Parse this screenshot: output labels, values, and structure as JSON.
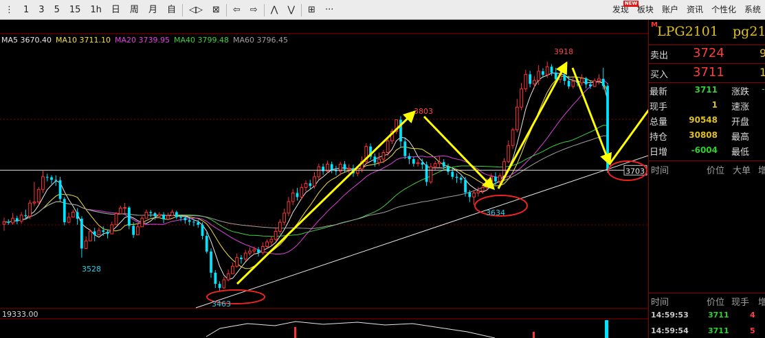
{
  "toolbar": {
    "items": [
      "⋮",
      "1",
      "3",
      "5",
      "15",
      "1h",
      "日",
      "周",
      "月",
      "自",
      "◁▷",
      "⊠",
      "⇦",
      "⇨",
      "⋀",
      "⋁",
      "⊞",
      "···"
    ],
    "right": [
      "发现",
      "板块",
      "账户",
      "资讯",
      "个性化",
      "系统"
    ],
    "new_badge": "NEW"
  },
  "ma_legend": [
    {
      "label": "MA5 3670.40",
      "color": "#e8e8e8"
    },
    {
      "label": "MA10 3711.10",
      "color": "#f0e040"
    },
    {
      "label": "MA20 3739.95",
      "color": "#e040e0"
    },
    {
      "label": "MA40 3799.48",
      "color": "#40d040"
    },
    {
      "label": "MA60 3796.45",
      "color": "#a0a0a0"
    }
  ],
  "volume_panel": {
    "label": "19333.00"
  },
  "chart_data": {
    "type": "candlestick",
    "y_range": [
      3440,
      3960
    ],
    "price_line": 3703,
    "price_line_label": "3703",
    "labels": [
      {
        "text": "3918",
        "price": 3918,
        "color": "#ff4444"
      },
      {
        "text": "3803",
        "price": 3803,
        "color": "#ff4444"
      },
      {
        "text": "3528",
        "price": 3528,
        "color": "#22d0e8"
      },
      {
        "text": "3463",
        "price": 3463,
        "color": "#22d0e8"
      },
      {
        "text": "3634",
        "price": 3634,
        "color": "#22d0e8"
      }
    ],
    "candles": [
      [
        3596,
        3601,
        3583,
        3609
      ],
      [
        3601,
        3599,
        3595,
        3606
      ],
      [
        3599,
        3608,
        3595,
        3618
      ],
      [
        3608,
        3602,
        3596,
        3613
      ],
      [
        3602,
        3614,
        3597,
        3620
      ],
      [
        3614,
        3612,
        3606,
        3625
      ],
      [
        3612,
        3638,
        3606,
        3644
      ],
      [
        3638,
        3640,
        3632,
        3680
      ],
      [
        3640,
        3665,
        3634,
        3670
      ],
      [
        3665,
        3690,
        3658,
        3702
      ],
      [
        3690,
        3689,
        3681,
        3696
      ],
      [
        3689,
        3684,
        3676,
        3693
      ],
      [
        3684,
        3683,
        3672,
        3693
      ],
      [
        3683,
        3646,
        3641,
        3690
      ],
      [
        3646,
        3600,
        3594,
        3650
      ],
      [
        3600,
        3610,
        3598,
        3619
      ],
      [
        3610,
        3620,
        3613,
        3625
      ],
      [
        3620,
        3607,
        3595,
        3628
      ],
      [
        3607,
        3548,
        3530,
        3612
      ],
      [
        3548,
        3563,
        3551,
        3572
      ],
      [
        3563,
        3582,
        3574,
        3586
      ],
      [
        3582,
        3575,
        3562,
        3589
      ],
      [
        3575,
        3584,
        3577,
        3590
      ],
      [
        3584,
        3581,
        3573,
        3592
      ],
      [
        3581,
        3577,
        3568,
        3586
      ],
      [
        3577,
        3595,
        3586,
        3601
      ],
      [
        3595,
        3617,
        3610,
        3620
      ],
      [
        3617,
        3628,
        3621,
        3633
      ],
      [
        3628,
        3629,
        3617,
        3638
      ],
      [
        3629,
        3593,
        3586,
        3632
      ],
      [
        3593,
        3575,
        3569,
        3600
      ],
      [
        3575,
        3591,
        3585,
        3597
      ],
      [
        3591,
        3608,
        3600,
        3612
      ],
      [
        3608,
        3620,
        3615,
        3625
      ],
      [
        3620,
        3618,
        3610,
        3624
      ],
      [
        3618,
        3612,
        3605,
        3620
      ],
      [
        3612,
        3615,
        3608,
        3620
      ],
      [
        3615,
        3606,
        3598,
        3620
      ],
      [
        3606,
        3613,
        3605,
        3619
      ],
      [
        3613,
        3620,
        3614,
        3625
      ],
      [
        3620,
        3610,
        3606,
        3623
      ],
      [
        3610,
        3609,
        3602,
        3615
      ],
      [
        3609,
        3604,
        3597,
        3612
      ],
      [
        3604,
        3601,
        3594,
        3610
      ],
      [
        3601,
        3600,
        3592,
        3606
      ],
      [
        3600,
        3595,
        3589,
        3605
      ],
      [
        3595,
        3573,
        3566,
        3600
      ],
      [
        3573,
        3542,
        3538,
        3580
      ],
      [
        3542,
        3500,
        3490,
        3548
      ],
      [
        3500,
        3478,
        3470,
        3505
      ],
      [
        3478,
        3470,
        3463,
        3483
      ],
      [
        3470,
        3486,
        3468,
        3492
      ],
      [
        3486,
        3498,
        3483,
        3506
      ],
      [
        3498,
        3513,
        3498,
        3520
      ],
      [
        3513,
        3530,
        3510,
        3538
      ],
      [
        3530,
        3527,
        3518,
        3535
      ],
      [
        3527,
        3539,
        3523,
        3545
      ],
      [
        3539,
        3543,
        3534,
        3550
      ],
      [
        3543,
        3546,
        3536,
        3552
      ],
      [
        3546,
        3540,
        3532,
        3551
      ],
      [
        3540,
        3552,
        3536,
        3560
      ],
      [
        3552,
        3561,
        3548,
        3566
      ],
      [
        3561,
        3566,
        3554,
        3572
      ],
      [
        3566,
        3582,
        3562,
        3590
      ],
      [
        3582,
        3600,
        3576,
        3606
      ],
      [
        3600,
        3618,
        3594,
        3627
      ],
      [
        3618,
        3641,
        3612,
        3650
      ],
      [
        3641,
        3658,
        3634,
        3666
      ],
      [
        3658,
        3650,
        3643,
        3668
      ],
      [
        3650,
        3669,
        3645,
        3676
      ],
      [
        3669,
        3677,
        3661,
        3683
      ],
      [
        3677,
        3672,
        3664,
        3684
      ],
      [
        3672,
        3690,
        3667,
        3699
      ],
      [
        3690,
        3710,
        3684,
        3716
      ],
      [
        3710,
        3701,
        3694,
        3716
      ],
      [
        3701,
        3715,
        3697,
        3722
      ],
      [
        3715,
        3703,
        3697,
        3720
      ],
      [
        3703,
        3701,
        3693,
        3712
      ],
      [
        3701,
        3715,
        3693,
        3720
      ],
      [
        3715,
        3705,
        3698,
        3721
      ],
      [
        3705,
        3707,
        3697,
        3715
      ],
      [
        3707,
        3697,
        3690,
        3714
      ],
      [
        3697,
        3706,
        3691,
        3711
      ],
      [
        3706,
        3720,
        3699,
        3730
      ],
      [
        3720,
        3750,
        3714,
        3756
      ],
      [
        3750,
        3730,
        3724,
        3756
      ],
      [
        3730,
        3718,
        3710,
        3736
      ],
      [
        3718,
        3725,
        3712,
        3738
      ],
      [
        3725,
        3738,
        3717,
        3743
      ],
      [
        3738,
        3761,
        3731,
        3768
      ],
      [
        3761,
        3780,
        3755,
        3785
      ],
      [
        3780,
        3803,
        3775,
        3803
      ],
      [
        3803,
        3760,
        3747,
        3810
      ],
      [
        3760,
        3731,
        3725,
        3766
      ],
      [
        3731,
        3725,
        3715,
        3737
      ],
      [
        3725,
        3716,
        3710,
        3730
      ],
      [
        3716,
        3718,
        3710,
        3725
      ],
      [
        3718,
        3714,
        3705,
        3726
      ],
      [
        3714,
        3680,
        3672,
        3720
      ],
      [
        3680,
        3710,
        3676,
        3717
      ],
      [
        3710,
        3716,
        3703,
        3721
      ],
      [
        3716,
        3719,
        3708,
        3730
      ],
      [
        3719,
        3710,
        3705,
        3725
      ],
      [
        3710,
        3700,
        3694,
        3716
      ],
      [
        3700,
        3690,
        3685,
        3710
      ],
      [
        3690,
        3688,
        3678,
        3697
      ],
      [
        3688,
        3684,
        3677,
        3692
      ],
      [
        3684,
        3659,
        3651,
        3690
      ],
      [
        3659,
        3650,
        3640,
        3664
      ],
      [
        3650,
        3658,
        3634,
        3664
      ],
      [
        3658,
        3662,
        3651,
        3670
      ],
      [
        3662,
        3669,
        3656,
        3677
      ],
      [
        3669,
        3681,
        3662,
        3687
      ],
      [
        3681,
        3690,
        3674,
        3697
      ],
      [
        3690,
        3681,
        3674,
        3699
      ],
      [
        3681,
        3692,
        3675,
        3697
      ],
      [
        3692,
        3720,
        3687,
        3727
      ],
      [
        3720,
        3752,
        3717,
        3762
      ],
      [
        3752,
        3783,
        3745,
        3787
      ],
      [
        3783,
        3828,
        3778,
        3844
      ],
      [
        3828,
        3864,
        3822,
        3876
      ],
      [
        3864,
        3893,
        3858,
        3902
      ],
      [
        3893,
        3874,
        3867,
        3900
      ],
      [
        3874,
        3881,
        3865,
        3889
      ],
      [
        3881,
        3899,
        3872,
        3911
      ],
      [
        3899,
        3892,
        3886,
        3905
      ],
      [
        3892,
        3908,
        3886,
        3918
      ],
      [
        3908,
        3896,
        3890,
        3913
      ],
      [
        3896,
        3883,
        3877,
        3906
      ],
      [
        3883,
        3892,
        3876,
        3900
      ],
      [
        3892,
        3880,
        3872,
        3898
      ],
      [
        3880,
        3869,
        3864,
        3890
      ],
      [
        3869,
        3879,
        3865,
        3887
      ],
      [
        3879,
        3876,
        3869,
        3888
      ],
      [
        3876,
        3885,
        3870,
        3893
      ],
      [
        3885,
        3873,
        3865,
        3888
      ],
      [
        3873,
        3869,
        3864,
        3880
      ],
      [
        3869,
        3880,
        3868,
        3885
      ],
      [
        3880,
        3884,
        3873,
        3893
      ],
      [
        3884,
        3870,
        3863,
        3906
      ],
      [
        3870,
        3705,
        3698,
        3876
      ]
    ],
    "volume_bars": [
      0,
      0,
      0,
      0,
      0,
      0,
      0,
      0,
      0,
      0,
      0,
      0,
      0,
      0,
      0,
      0,
      0,
      0,
      0,
      0,
      0,
      0,
      0,
      0,
      0,
      0,
      0,
      0,
      0,
      0,
      0,
      0,
      0,
      0,
      0,
      0,
      0,
      0,
      0,
      0,
      0,
      0,
      0,
      0,
      0,
      0,
      0,
      0,
      0,
      0,
      0,
      0,
      0,
      0,
      0,
      0,
      0,
      0,
      0,
      0,
      0,
      0,
      0,
      0,
      0,
      0,
      0,
      0,
      0,
      0,
      0,
      0,
      0,
      0,
      0,
      0,
      0,
      0,
      0,
      0,
      0,
      0,
      0,
      0,
      0,
      0,
      0,
      0,
      0,
      0,
      0,
      0,
      0,
      0,
      0,
      0,
      0,
      0,
      0,
      0,
      0,
      0,
      0,
      0,
      0,
      0,
      0,
      0,
      0,
      0,
      0,
      0,
      0,
      0,
      0,
      0,
      0,
      0,
      0,
      0,
      0,
      0,
      0,
      0,
      0,
      0,
      0,
      0,
      0,
      0,
      0,
      0,
      0,
      0,
      0,
      0,
      0,
      0,
      0,
      0,
      0,
      0,
      1
    ]
  },
  "panel": {
    "m_marker": "M",
    "code": "LPG2101",
    "name": "pg21",
    "sell_label": "卖出",
    "sell_price": "3724",
    "sell_vol": "9",
    "buy_label": "买入",
    "buy_price": "3711",
    "buy_vol": "1",
    "quotes_left": [
      {
        "label": "最新",
        "value": "3711",
        "color": "#30d030"
      },
      {
        "label": "现手",
        "value": "1",
        "color": "#e0c020"
      },
      {
        "label": "总量",
        "value": "90548",
        "color": "#e0c020"
      },
      {
        "label": "持仓",
        "value": "30808",
        "color": "#e0c020"
      },
      {
        "label": "日增",
        "value": "-6004",
        "color": "#30d030"
      }
    ],
    "quotes_right": [
      "涨跌",
      "速涨",
      "开盘",
      "最高",
      "最低"
    ],
    "quote_right_val": "-",
    "tick_headers": [
      "时间",
      "价位",
      "大单",
      "增"
    ],
    "trade_headers": [
      "时间",
      "价位",
      "现手",
      "增"
    ],
    "trades": [
      {
        "time": "14:59:53",
        "price": "3711",
        "vol": "4"
      },
      {
        "time": "14:59:54",
        "price": "3711",
        "vol": "5"
      }
    ]
  }
}
